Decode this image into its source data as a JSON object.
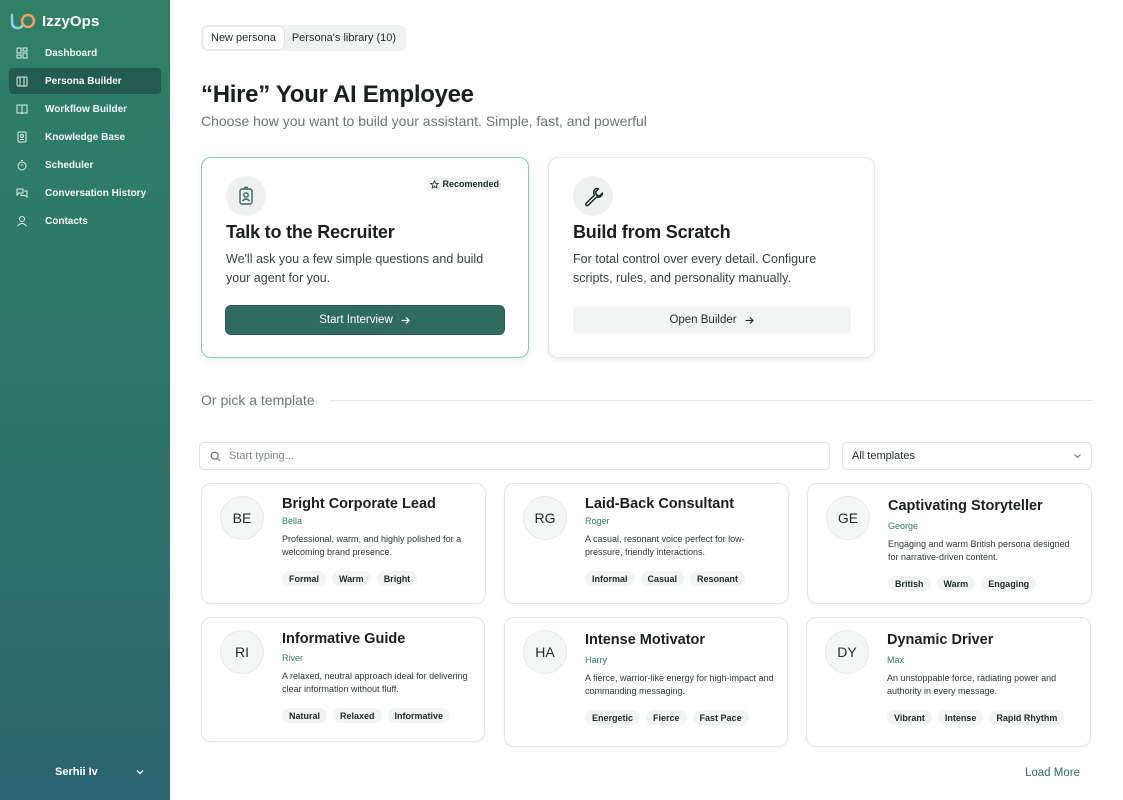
{
  "app": {
    "name": "IzzyOps"
  },
  "sidebar": {
    "items": [
      {
        "label": "Dashboard",
        "icon": "dashboard-icon"
      },
      {
        "label": "Persona Builder",
        "icon": "persona-icon",
        "active": true
      },
      {
        "label": "Workflow Builder",
        "icon": "book-icon"
      },
      {
        "label": "Knowledge Base",
        "icon": "knowledge-icon"
      },
      {
        "label": "Scheduler",
        "icon": "timer-icon"
      },
      {
        "label": "Conversation History",
        "icon": "chat-icon"
      },
      {
        "label": "Contacts",
        "icon": "user-icon"
      }
    ],
    "user": {
      "name": "Serhii Iv"
    }
  },
  "tabs": [
    {
      "label": "New persona",
      "active": true
    },
    {
      "label": "Persona's library (10)",
      "active": false
    }
  ],
  "hero": {
    "title": "“Hire” Your AI Employee",
    "subtitle": "Choose how you want to build your assistant. Simple, fast, and powerful"
  },
  "cards": {
    "recruiter": {
      "badge": "Recomended",
      "title": "Talk to the Recruiter",
      "description": "We'll ask you a few simple questions and build your agent for you.",
      "button": "Start Interview"
    },
    "scratch": {
      "title": "Build from Scratch",
      "description": "For total control over every detail. Configure scripts, rules, and personality manually.",
      "button": "Open Builder"
    }
  },
  "templates": {
    "section_label": "Or pick a template",
    "search_placeholder": "Start typing...",
    "filter_value": "All templates",
    "load_more": "Load More",
    "items": [
      {
        "initials": "BE",
        "name": "Bright Corporate Lead",
        "voice": "Bella",
        "description": "Professional, warm, and highly polished for a welcoming brand presence.",
        "tags": [
          "Formal",
          "Warm",
          "Bright"
        ]
      },
      {
        "initials": "RG",
        "name": "Laid-Back Consultant",
        "voice": "Roger",
        "description": "A casual, resonant voice perfect for low-pressure, friendly interactions.",
        "tags": [
          "Informal",
          "Casual",
          "Resonant"
        ]
      },
      {
        "initials": "GE",
        "name": "Captivating Storyteller",
        "voice": "George",
        "description": "Engaging and warm British persona designed for narrative-driven content.",
        "tags": [
          "British",
          "Warm",
          "Engaging"
        ]
      },
      {
        "initials": "RI",
        "name": "Informative Guide",
        "voice": "River",
        "description": "A relaxed, neutral approach ideal for delivering clear information without fluff.",
        "tags": [
          "Natural",
          "Relaxed",
          "Informative"
        ]
      },
      {
        "initials": "HA",
        "name": "Intense Motivator",
        "voice": "Harry",
        "description": "A fierce, warrior-like energy for high-impact and commanding messaging.",
        "tags": [
          "Energetic",
          "Fierce",
          "Fast Pace"
        ]
      },
      {
        "initials": "DY",
        "name": "Dynamic Driver",
        "voice": "Max",
        "description": "An unstoppable force, radiating power and authority in every message.",
        "tags": [
          "Vibrant",
          "Intense",
          "Rapid Rhythm"
        ]
      }
    ]
  },
  "colors": {
    "sidebar_top": "#2f8066",
    "sidebar_bottom": "#2b6570",
    "primary": "#2f6b5e",
    "accent_border": "#87c9b3",
    "voice_text": "#2f7a62"
  }
}
